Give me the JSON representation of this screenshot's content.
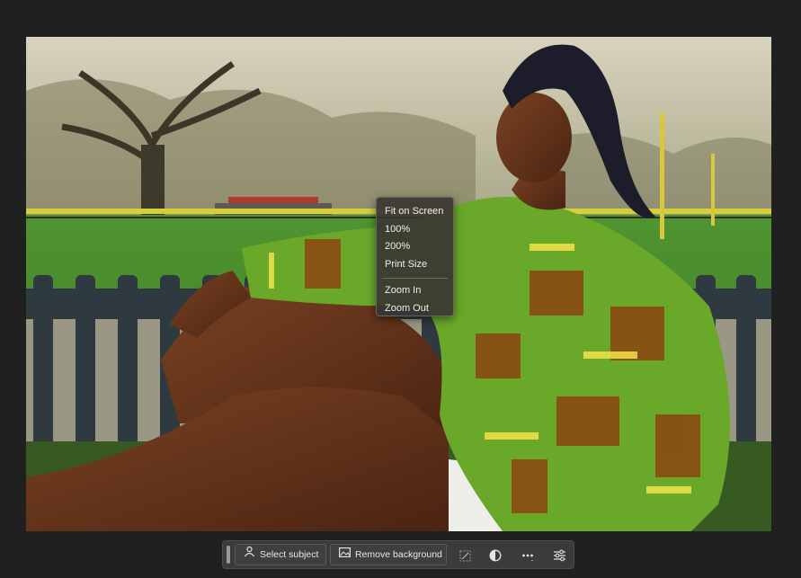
{
  "zoom_menu": {
    "items": [
      "Fit on Screen",
      "100%",
      "200%",
      "Print Size"
    ],
    "zoom_items": [
      "Zoom In",
      "Zoom Out"
    ]
  },
  "taskbar": {
    "select_subject_label": "Select subject",
    "remove_background_label": "Remove background",
    "icons": [
      "person-select-icon",
      "image-icon",
      "transform-icon",
      "adjust-contrast-icon",
      "more-icon",
      "sliders-icon"
    ]
  },
  "colors": {
    "app_background": "#202020",
    "menu_background": "#3a3632",
    "taskbar_background": "#3b3b3b"
  }
}
